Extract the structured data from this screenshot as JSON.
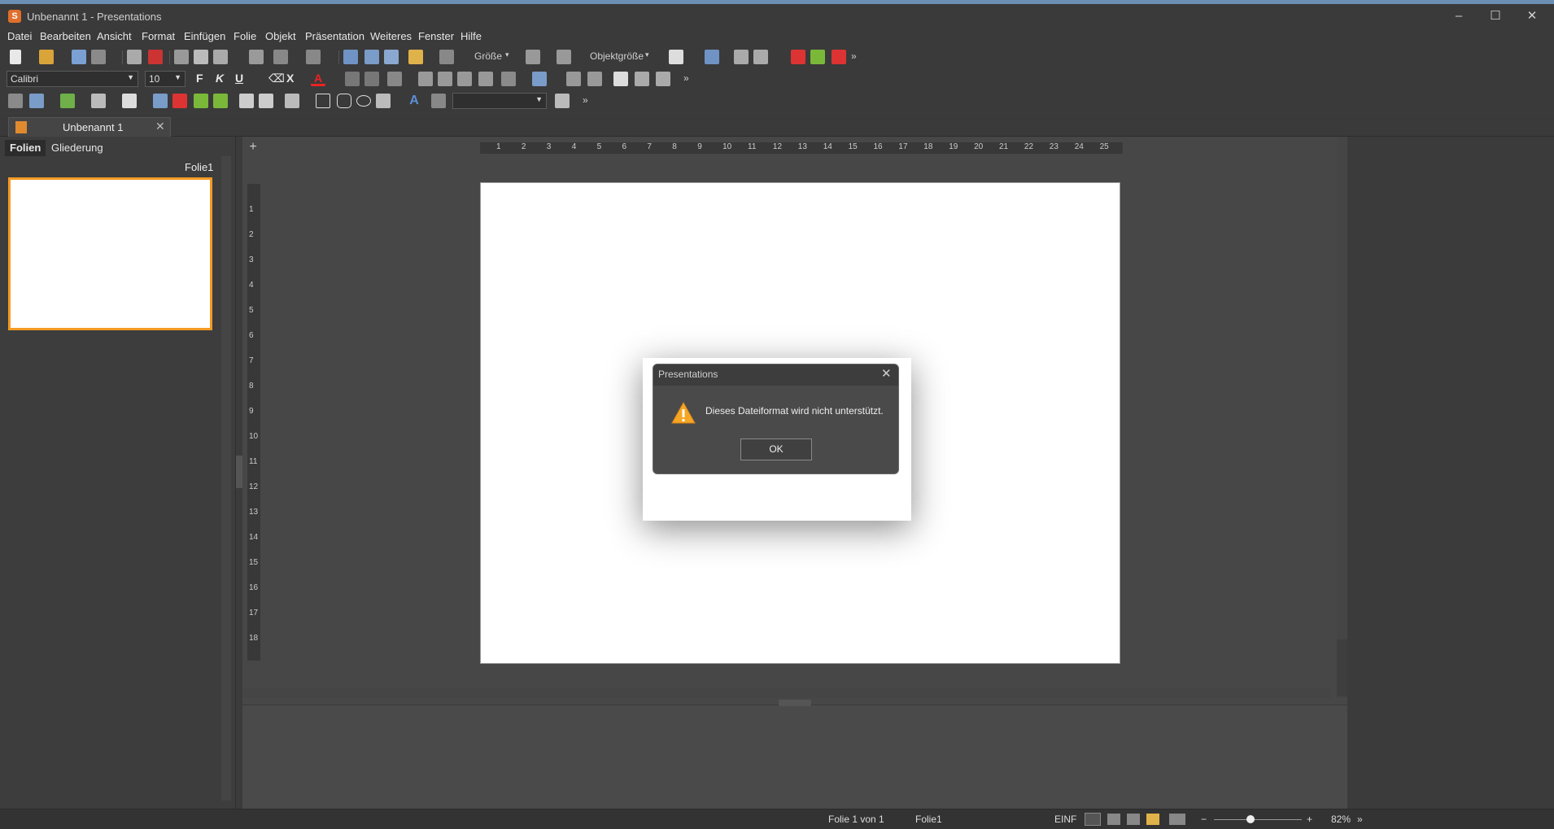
{
  "window": {
    "title": "Unbenannt 1 - Presentations"
  },
  "menubar": {
    "items": [
      "Datei",
      "Bearbeiten",
      "Ansicht",
      "Format",
      "Einfügen",
      "Folie",
      "Objekt",
      "Präsentation",
      "Weiteres",
      "Fenster",
      "Hilfe"
    ]
  },
  "toolbar1": {
    "size_label": "Größe",
    "object_size_label": "Objektgröße"
  },
  "toolbar2": {
    "font": "Calibri",
    "font_size": "10",
    "bold": "F",
    "italic": "K",
    "underline": "U",
    "strike": "X"
  },
  "tabs": {
    "document": "Unbenannt 1"
  },
  "left_panel": {
    "tab_slides": "Folien",
    "tab_outline": "Gliederung",
    "slide_name": "Folie1"
  },
  "ruler": {
    "h": [
      "1",
      "2",
      "3",
      "4",
      "5",
      "6",
      "7",
      "8",
      "9",
      "10",
      "11",
      "12",
      "13",
      "14",
      "15",
      "16",
      "17",
      "18",
      "19",
      "20",
      "21",
      "22",
      "23",
      "24",
      "25"
    ],
    "v": [
      "1",
      "2",
      "3",
      "4",
      "5",
      "6",
      "7",
      "8",
      "9",
      "10",
      "11",
      "12",
      "13",
      "14",
      "15",
      "16",
      "17",
      "18"
    ]
  },
  "dialog": {
    "title": "Presentations",
    "message": "Dieses Dateiformat wird nicht unterstützt.",
    "ok": "OK"
  },
  "statusbar": {
    "slide_pos": "Folie 1 von 1",
    "slide_name": "Folie1",
    "mode": "EINF",
    "zoom": "82%"
  },
  "colors": {
    "accent": "#f59a23",
    "warning": "#f5a623"
  }
}
